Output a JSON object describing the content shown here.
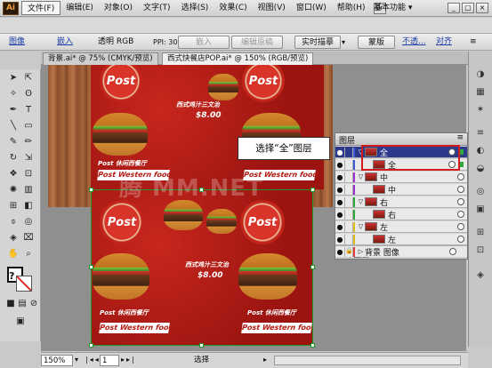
{
  "app": {
    "logo": "Ai",
    "workspace": "基本功能 ▾",
    "window_buttons": [
      "_",
      "▢",
      "×"
    ]
  },
  "menubar": [
    "文件(F)",
    "编辑(E)",
    "对象(O)",
    "文字(T)",
    "选择(S)",
    "效果(C)",
    "视图(V)",
    "窗口(W)",
    "帮助(H)"
  ],
  "control_bar": {
    "item_type": "图像",
    "embed_link": "嵌入",
    "color_mode": "透明 RGB",
    "ppi": "PPI: 300",
    "embed_button": "嵌入",
    "edit_original_button": "编辑原稿",
    "live_trace_button": "实时描摹",
    "mask_button": "蒙版",
    "opacity_link": "不透...",
    "align_link": "对齐"
  },
  "tabs": [
    {
      "label": "背景.ai* @ 75% (CMYK/预览)"
    },
    {
      "label": "西式快餐店POP.ai* @ 150% (RGB/预览)"
    }
  ],
  "artwork": {
    "brand": "Post",
    "tagline": "Post Western food",
    "subtitle_top": "Post 休闲西餐厅",
    "dish_label": "西式鸡汁三文治",
    "price": "$8.00",
    "watermark": "腾 MM.NET"
  },
  "callout": "选择“全”图层",
  "layers_panel": {
    "title": "图层",
    "layers": [
      {
        "name": "全",
        "level": 0,
        "selected": true
      },
      {
        "name": "全",
        "level": 1,
        "selected": false
      },
      {
        "name": "中",
        "level": 0,
        "selected": false
      },
      {
        "name": "中",
        "level": 1,
        "selected": false
      },
      {
        "name": "右",
        "level": 0,
        "selected": false
      },
      {
        "name": "右",
        "level": 1,
        "selected": false
      },
      {
        "name": "左",
        "level": 0,
        "selected": false
      },
      {
        "name": "左",
        "level": 1,
        "selected": false
      },
      {
        "name": "背景 图像",
        "level": 0,
        "selected": false
      }
    ],
    "footer_count": "5 个图层"
  },
  "status_bar": {
    "zoom": "150%",
    "page": "1",
    "mode": "选择"
  },
  "colors": {
    "selection": "#1e9a2a",
    "highlight_frame": "#d41b1b",
    "layer_selected": "#2d3a8c",
    "menu_red": "#b01a12"
  }
}
